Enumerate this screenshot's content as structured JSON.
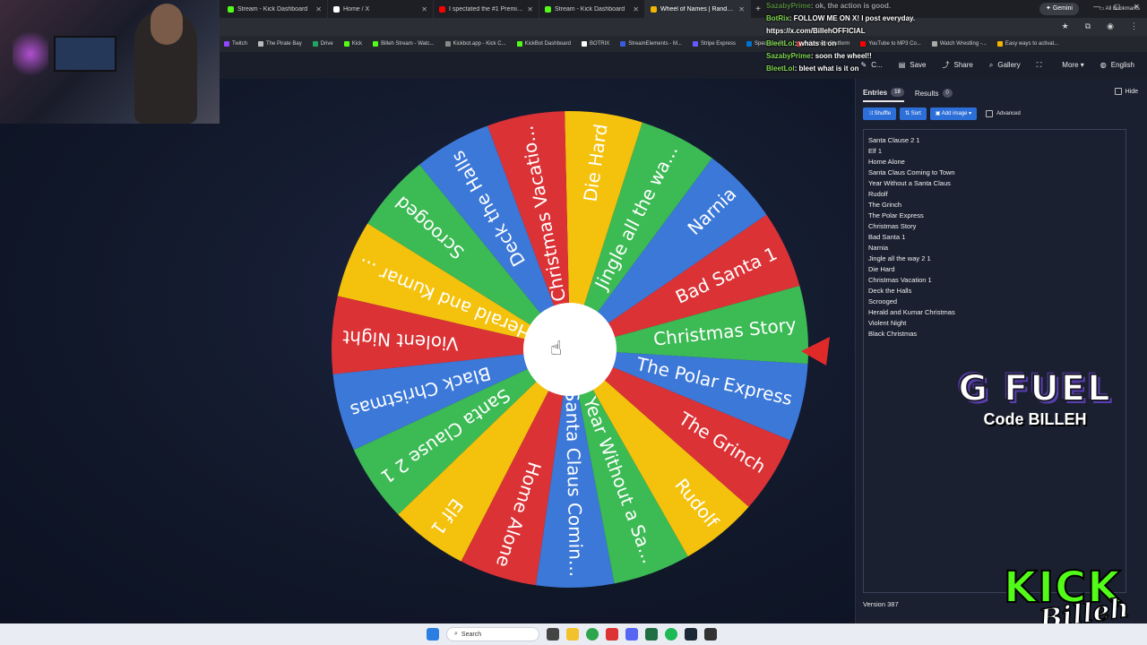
{
  "browser": {
    "tabs": [
      {
        "title": "Stream - Kick Dashboard",
        "color": "#53fc18",
        "active": false
      },
      {
        "title": "Home / X",
        "color": "#ffffff",
        "active": false
      },
      {
        "title": "I spectated the #1 Premier Play",
        "color": "#ff0000",
        "active": false
      },
      {
        "title": "Stream - Kick Dashboard",
        "color": "#53fc18",
        "active": false
      },
      {
        "title": "Wheel of Names | Random",
        "color": "#f4b400",
        "active": true
      }
    ],
    "gemini_label": "Gemini",
    "bookmarks": [
      {
        "label": "Twitch",
        "color": "#9146ff"
      },
      {
        "label": "The Pirate Bay",
        "color": "#bbbbbb"
      },
      {
        "label": "Drive",
        "color": "#1fa463"
      },
      {
        "label": "Kick",
        "color": "#53fc18"
      },
      {
        "label": "Billeh Stream - Watc...",
        "color": "#53fc18"
      },
      {
        "label": "Kickbot.app - Kick C...",
        "color": "#888888"
      },
      {
        "label": "KickBot Dashboard",
        "color": "#53fc18"
      },
      {
        "label": "BOTRIX",
        "color": "#ffffff"
      },
      {
        "label": "StreamElements - M...",
        "color": "#3b5bdb"
      },
      {
        "label": "Stripe Express",
        "color": "#635bff"
      },
      {
        "label": "Spectrum TV",
        "color": "#0073d1"
      },
      {
        "label": "Influencer Platform",
        "color": "#dd4444"
      },
      {
        "label": "YouTube to MP3 Co...",
        "color": "#ff0000"
      },
      {
        "label": "Watch Wrestling -...",
        "color": "#aaaaaa"
      },
      {
        "label": "Easy ways to activat...",
        "color": "#f4b400"
      }
    ],
    "all_bookmarks": "All Bookmarks"
  },
  "chat": [
    {
      "user": "SazabyPrime",
      "msg": ": ok, the action is good.",
      "faint": true
    },
    {
      "user": "BotRix",
      "msg": ": FOLLOW ME ON X! I post everyday.",
      "faint": false
    },
    {
      "user": "",
      "msg": "https://x.com/BillehOFFICIAL",
      "faint": false
    },
    {
      "user": "BleetLol",
      "msg": ": whats it on",
      "faint": false
    },
    {
      "user": "SazabyPrime",
      "msg": ": soon the wheel!!",
      "faint": false
    },
    {
      "user": "BleetLol",
      "msg": ": bleet what is it on",
      "faint": false
    }
  ],
  "app_header": {
    "actions": [
      {
        "icon": "customize-icon",
        "label": "C..."
      },
      {
        "icon": "save-icon",
        "label": "Save"
      },
      {
        "icon": "share-icon",
        "label": "Share"
      },
      {
        "icon": "search-icon",
        "label": "Gallery"
      },
      {
        "icon": "fullscreen-icon",
        "label": ""
      },
      {
        "icon": "more-icon",
        "label": "More"
      },
      {
        "icon": "globe-icon",
        "label": "English"
      }
    ]
  },
  "wheel": {
    "colors": [
      "#db3236",
      "#3c78d8",
      "#3cba54",
      "#f4c20d"
    ],
    "slices": [
      "Bad Santa 1",
      "Narnia",
      "Jingle all the wa...",
      "Die Hard",
      "Christmas Vacatio...",
      "Deck the Halls",
      "Scrooged",
      "Herald and Kumar ...",
      "Violent Night",
      "Black Christmas",
      "Santa Clause 2 1",
      "Elf 1",
      "Home Alone",
      "Santa Claus Comin...",
      "Year Without a Sa...",
      "Rudolf",
      "The Grinch",
      "The Polar Express",
      "Christmas Story"
    ]
  },
  "panel": {
    "tabs": [
      {
        "label": "Entries",
        "count": "19",
        "active": true
      },
      {
        "label": "Results",
        "count": "0",
        "active": false
      }
    ],
    "hide_label": "Hide",
    "tools": {
      "shuffle": "Shuffle",
      "sort": "Sort",
      "add_image": "Add image",
      "advanced": "Advanced"
    },
    "entries": [
      "Santa Clause 2 1",
      "Elf 1",
      "Home Alone",
      "Santa Claus Coming to Town",
      "Year Without a Santa Claus",
      "Rudolf",
      "The Grinch",
      "The Polar Express",
      "Christmas Story",
      "Bad Santa 1",
      "Narnia",
      "Jingle all the way 2 1",
      "Die Hard",
      "Christmas Vacation 1",
      "Deck the Halls",
      "Scrooged",
      "Herald and Kumar Christmas",
      "Violent Night",
      "Black Christmas"
    ],
    "version": "Version 387"
  },
  "overlays": {
    "gfuel_logo": "G FUEL",
    "gfuel_code": "Code BILLEH",
    "kick_logo": "KICK",
    "kick_sig": "Billeh"
  },
  "taskbar": {
    "search_placeholder": "Search"
  }
}
